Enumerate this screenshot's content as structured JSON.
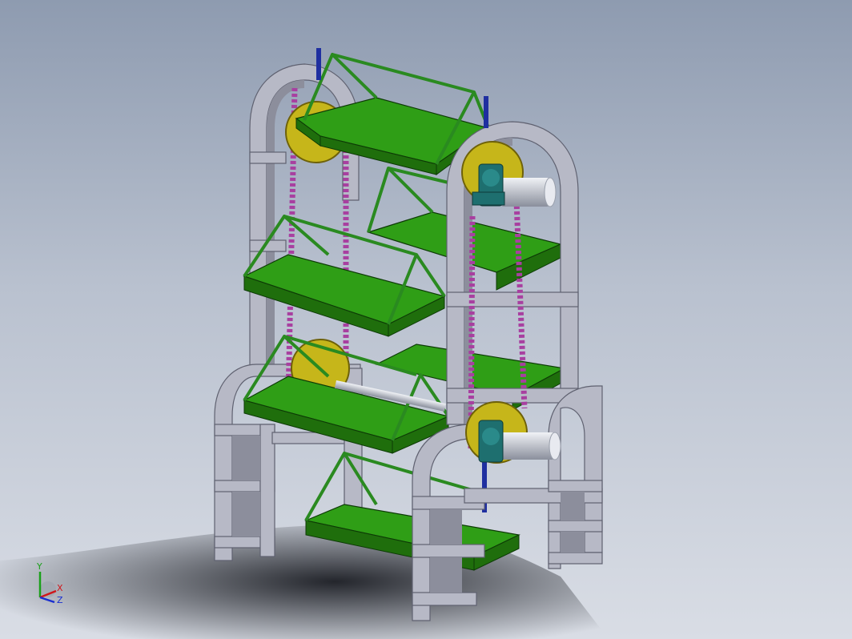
{
  "viewport": {
    "colors": {
      "background_top": "#8e9bb0",
      "background_bottom": "#d9dde5",
      "frame": "#b7b9c6",
      "frame_dark": "#8c8e9c",
      "tray": "#2f9e16",
      "tray_dark": "#1f6e0c",
      "rod": "#2a8a20",
      "sprocket": "#c6b61a",
      "chain": "#a83fa0",
      "bearing": "#1e6f6f",
      "shaft": "#c9cdd6",
      "bracket": "#1f2fa0"
    }
  },
  "triad": {
    "x_label": "X",
    "y_label": "Y",
    "z_label": "Z",
    "x_color": "#d0161a",
    "y_color": "#1aa01a",
    "z_color": "#1a2fd0"
  }
}
